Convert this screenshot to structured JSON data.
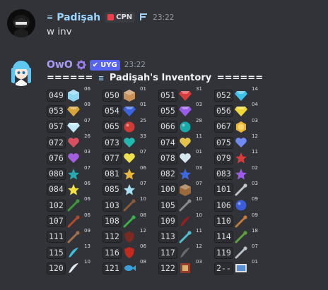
{
  "message1": {
    "username": "Padişah",
    "username_color": "#9ed6ff",
    "tag": "CPN",
    "time": "23:22",
    "text": "w inv"
  },
  "message2": {
    "username": "OwO",
    "username_color": "#a89af7",
    "bot_tag": "UYG",
    "time": "23:22",
    "title_left": "======",
    "title_name": "Padişah's Inventory",
    "title_right": "======"
  },
  "inventory": [
    [
      {
        "code": "049",
        "n": "06",
        "icon": "ice-cube",
        "c": "#8fd7f5"
      },
      {
        "code": "050",
        "n": "01",
        "icon": "box",
        "c": "#c8925a"
      },
      {
        "code": "051",
        "n": "31",
        "icon": "ruby-gem",
        "c": "#d83b3b"
      },
      {
        "code": "052",
        "n": "14",
        "icon": "diamond-gem",
        "c": "#3ec0ea"
      }
    ],
    [
      {
        "code": "053",
        "n": "08",
        "icon": "topaz-gem",
        "c": "#d9a437"
      },
      {
        "code": "054",
        "n": "01",
        "icon": "sapphire-gem",
        "c": "#3b63e0"
      },
      {
        "code": "055",
        "n": "03",
        "icon": "amethyst-gem",
        "c": "#9b5be8"
      },
      {
        "code": "056",
        "n": "04",
        "icon": "yellow-gem",
        "c": "#f0d936"
      }
    ],
    [
      {
        "code": "057",
        "n": "07",
        "icon": "white-gem",
        "c": "#bfe8fa"
      },
      {
        "code": "065",
        "n": "25",
        "icon": "red-sphere",
        "c": "#cc3b36"
      },
      {
        "code": "066",
        "n": "28",
        "icon": "teal-sphere",
        "c": "#1aa8a8"
      },
      {
        "code": "067",
        "n": "03",
        "icon": "gold-coin",
        "c": "#e8b73a"
      }
    ],
    [
      {
        "code": "072",
        "n": "26",
        "icon": "red-heart",
        "c": "#d85060"
      },
      {
        "code": "073",
        "n": "33",
        "icon": "teal-heart",
        "c": "#25b8b0"
      },
      {
        "code": "074",
        "n": "11",
        "icon": "gold-heart",
        "c": "#e3c34a"
      },
      {
        "code": "075",
        "n": "12",
        "icon": "blue-heart",
        "c": "#6f8af0"
      }
    ],
    [
      {
        "code": "076",
        "n": "03",
        "icon": "purple-heart",
        "c": "#a45fe0"
      },
      {
        "code": "077",
        "n": "07",
        "icon": "yellow-heart",
        "c": "#f0e050"
      },
      {
        "code": "078",
        "n": "01",
        "icon": "white-heart",
        "c": "#d8e8f0"
      },
      {
        "code": "079",
        "n": "11",
        "icon": "red-star",
        "c": "#d83b3b"
      }
    ],
    [
      {
        "code": "080",
        "n": "07",
        "icon": "teal-star",
        "c": "#25aab0"
      },
      {
        "code": "081",
        "n": "06",
        "icon": "gold-star",
        "c": "#e8b73a"
      },
      {
        "code": "082",
        "n": "03",
        "icon": "blue-star",
        "c": "#4066e0"
      },
      {
        "code": "083",
        "n": "02",
        "icon": "purple-star",
        "c": "#9b5be8"
      }
    ],
    [
      {
        "code": "084",
        "n": "06",
        "icon": "yellow-star",
        "c": "#f0e040"
      },
      {
        "code": "085",
        "n": "07",
        "icon": "white-star",
        "c": "#a8e0f5"
      },
      {
        "code": "100",
        "n": "07",
        "icon": "crate",
        "c": "#9c6a3a"
      },
      {
        "code": "101",
        "n": "03",
        "icon": "sword",
        "c": "#c0c6cc"
      }
    ],
    [
      {
        "code": "102",
        "n": "06",
        "icon": "green-staff",
        "c": "#3c9a3a"
      },
      {
        "code": "103",
        "n": "10",
        "icon": "wand",
        "c": "#8c5a38"
      },
      {
        "code": "105",
        "n": "10",
        "icon": "mace",
        "c": "#8a8a8a"
      },
      {
        "code": "106",
        "n": "09",
        "icon": "orb",
        "c": "#3a5ed8"
      }
    ],
    [
      {
        "code": "107",
        "n": "06",
        "icon": "fire-staff",
        "c": "#b04a2a"
      },
      {
        "code": "108",
        "n": "08",
        "icon": "green-wand",
        "c": "#3cb04a"
      },
      {
        "code": "109",
        "n": "10",
        "icon": "blood-scythe",
        "c": "#9a2020"
      },
      {
        "code": "110",
        "n": "09",
        "icon": "bow",
        "c": "#c47a3a"
      }
    ],
    [
      {
        "code": "111",
        "n": "09",
        "icon": "axe",
        "c": "#a07050"
      },
      {
        "code": "112",
        "n": "12",
        "icon": "shield",
        "c": "#7a2a20"
      },
      {
        "code": "113",
        "n": "11",
        "icon": "ice-spear",
        "c": "#4ac0d0"
      },
      {
        "code": "114",
        "n": "18",
        "icon": "vine-staff",
        "c": "#60a040"
      }
    ],
    [
      {
        "code": "115",
        "n": "13",
        "icon": "feather",
        "c": "#40c0e0"
      },
      {
        "code": "116",
        "n": "06",
        "icon": "red-shield",
        "c": "#c02a20"
      },
      {
        "code": "117",
        "n": "12",
        "icon": "scythe",
        "c": "#6a6a6a"
      },
      {
        "code": "119",
        "n": "07",
        "icon": "wrench",
        "c": "#b8c0c8"
      }
    ],
    [
      {
        "code": "120",
        "n": "10",
        "icon": "claw",
        "c": "#e0e8f0"
      },
      {
        "code": "121",
        "n": "08",
        "icon": "fish",
        "c": "#3aa0d8"
      },
      {
        "code": "122",
        "n": "03",
        "icon": "banner",
        "c": "#9a3a2a"
      },
      {
        "code": "2--",
        "n": "01",
        "icon": "picture-frame",
        "c": "#5a8fd8"
      }
    ]
  ]
}
